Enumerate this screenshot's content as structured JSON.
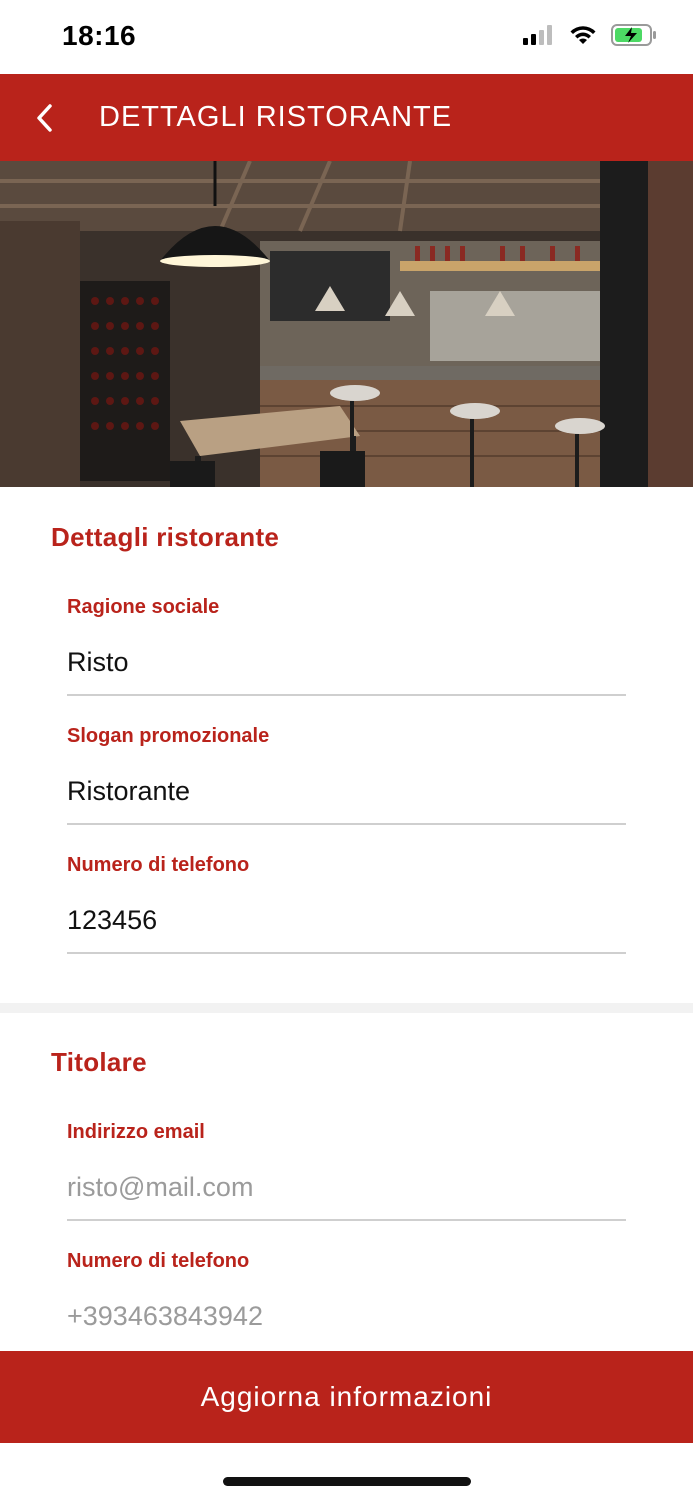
{
  "status_bar": {
    "time": "18:16"
  },
  "header": {
    "title": "DETTAGLI RISTORANTE"
  },
  "restaurant_section": {
    "title": "Dettagli ristorante",
    "fields": [
      {
        "label": "Ragione sociale",
        "value": "Risto"
      },
      {
        "label": "Slogan promozionale",
        "value": "Ristorante"
      },
      {
        "label": "Numero di telefono",
        "value": "123456"
      }
    ]
  },
  "owner_section": {
    "title": "Titolare",
    "fields": [
      {
        "label": "Indirizzo email",
        "value": "risto@mail.com"
      },
      {
        "label": "Numero di telefono",
        "value": "+393463843942"
      }
    ]
  },
  "actions": {
    "update_label": "Aggiorna informazioni"
  },
  "colors": {
    "accent": "#b9231b",
    "field_line": "#cfcfcf",
    "muted_text": "#9b9b9b"
  },
  "icons": [
    "back-arrow-icon",
    "signal-icon",
    "wifi-icon",
    "battery-charging-icon"
  ]
}
